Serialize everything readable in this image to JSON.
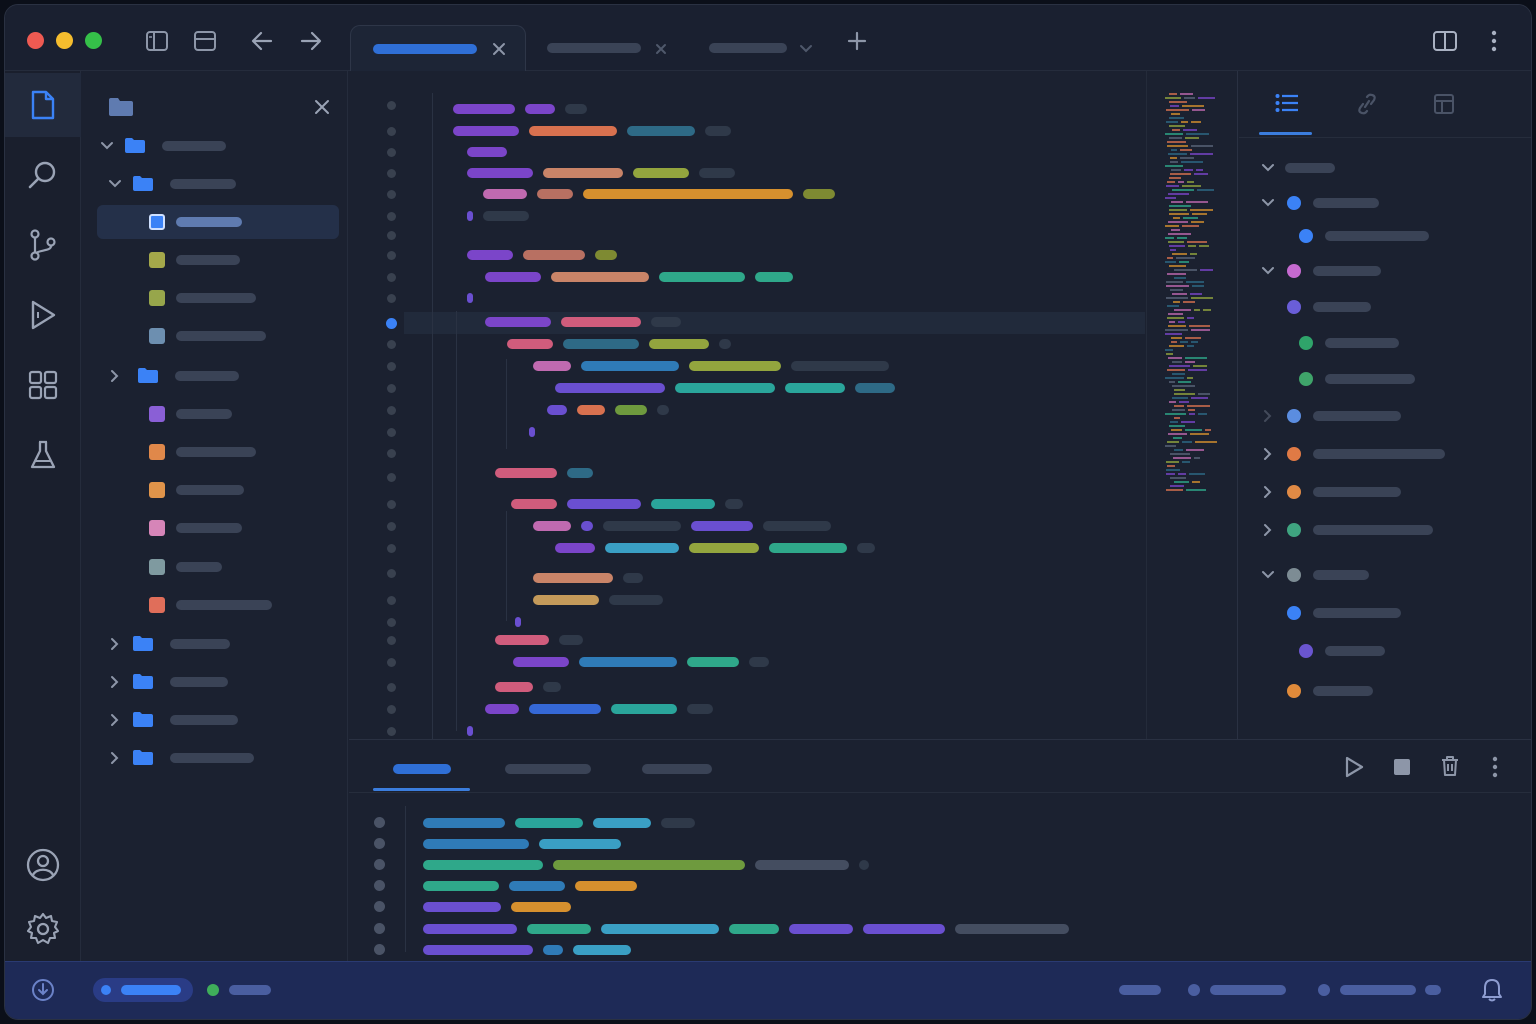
{
  "app": {
    "colors": {
      "accent": "#3b7ddd",
      "close": "#ee5a52",
      "minimize": "#f5bd2e",
      "maximize": "#35c049",
      "status_bar": "#1e2a57"
    }
  },
  "titlebar": {
    "icons": [
      "sidebar-toggle-icon",
      "panel-toggle-icon",
      "back-arrow-icon",
      "forward-arrow-icon",
      "new-tab-icon",
      "split-view-icon",
      "more-menu-icon"
    ]
  },
  "tabs": [
    {
      "state": "active",
      "close_icon": "close-icon"
    },
    {
      "state": "inactive",
      "close_icon": "close-icon"
    },
    {
      "state": "inactive",
      "close_icon": "chevron-down-icon"
    }
  ],
  "activity_bar": {
    "items": [
      "files-icon",
      "search-icon",
      "source-control-icon",
      "run-debug-icon",
      "extensions-icon",
      "testing-flask-icon"
    ],
    "bottom": [
      "account-icon",
      "settings-gear-icon"
    ]
  },
  "explorer": {
    "header_icon": "folder-icon",
    "close_icon": "close-icon",
    "file_colors": [
      "#6d86b0",
      "#a4a84a",
      "#97a64b",
      "#6d8fb0",
      "#8a5fd6",
      "#e0884a",
      "#e0944a",
      "#d685b8",
      "#7f9aa0",
      "#e06e5a"
    ]
  },
  "outline": {
    "icons": [
      "list-icon",
      "link-icon",
      "layout-icon"
    ],
    "dot_colors": [
      "#3b82f6",
      "#3b82f6",
      "#c56ad0",
      "#6a5ed8",
      "#2fa46a",
      "#3fa46a",
      "#5b8de0",
      "#e07a45",
      "#e08a45",
      "#3fa480",
      "#7d8c94",
      "#3b82f6",
      "#6a55d0",
      "#e08a3a"
    ]
  },
  "panel": {
    "actions": [
      "run-icon",
      "stop-icon",
      "trash-icon",
      "more-menu-icon"
    ]
  },
  "statusbar": {
    "icons": [
      "sync-status-icon",
      "notification-bell-icon"
    ]
  }
}
